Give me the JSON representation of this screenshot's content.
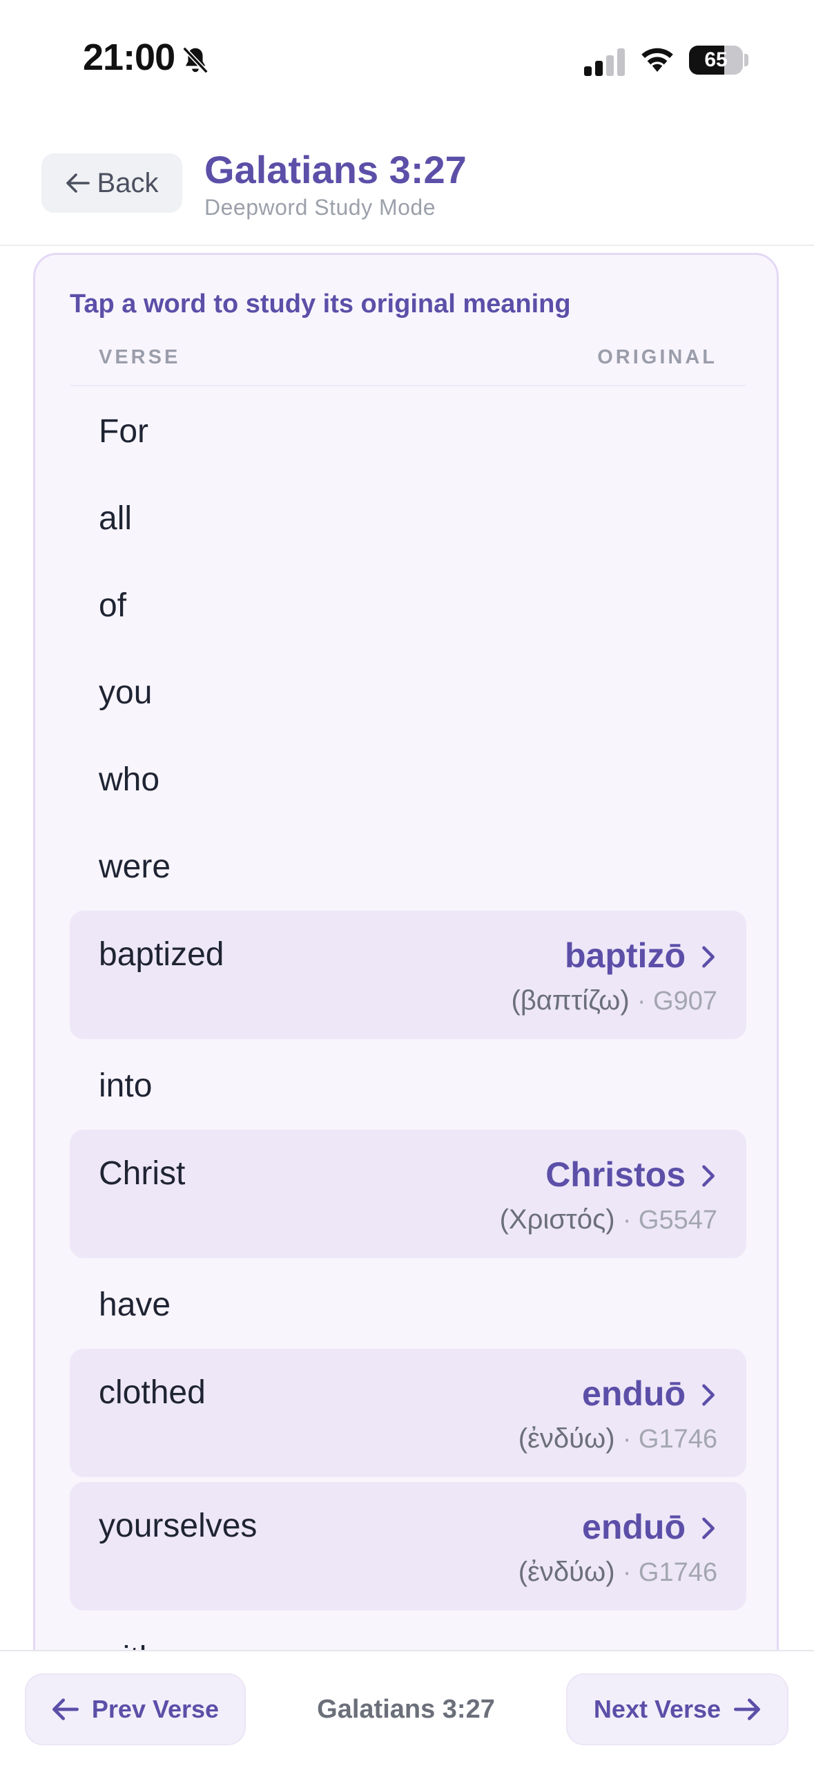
{
  "status_bar": {
    "time": "21:00",
    "battery": "65",
    "battery_fraction": 0.65
  },
  "header": {
    "back_label": "Back",
    "title": "Galatians 3:27",
    "subtitle": "Deepword Study Mode"
  },
  "card": {
    "instruction": "Tap a word to study its original meaning",
    "col_verse": "VERSE",
    "col_original": "ORIGINAL",
    "words": [
      {
        "text": "For"
      },
      {
        "text": "all"
      },
      {
        "text": "of"
      },
      {
        "text": "you"
      },
      {
        "text": "who"
      },
      {
        "text": "were"
      },
      {
        "text": "baptized",
        "translit": "baptizō",
        "original": "(βαπτίζω)",
        "strongs": "G907"
      },
      {
        "text": "into"
      },
      {
        "text": "Christ",
        "translit": "Christos",
        "original": "(Χριστός)",
        "strongs": "G5547"
      },
      {
        "text": "have"
      },
      {
        "text": "clothed",
        "translit": "enduō",
        "original": "(ἐνδύω)",
        "strongs": "G1746"
      },
      {
        "text": "yourselves",
        "translit": "enduō",
        "original": "(ἐνδύω)",
        "strongs": "G1746"
      },
      {
        "text": "with"
      }
    ]
  },
  "bottom": {
    "prev_label": "Prev Verse",
    "reference": "Galatians 3:27",
    "next_label": "Next Verse"
  },
  "colors": {
    "accent": "#5b4fa8",
    "card_bg": "#f9f5fd",
    "linked_row_bg": "#eee7f7"
  }
}
